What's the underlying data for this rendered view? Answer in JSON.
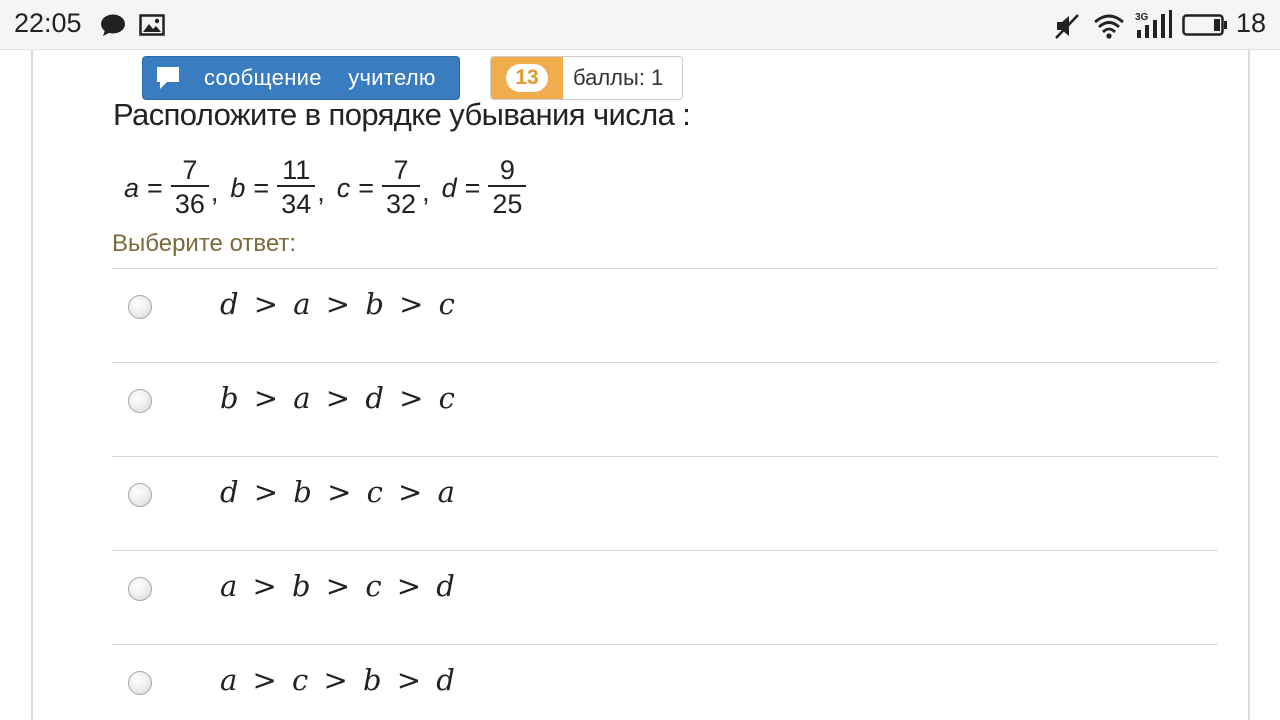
{
  "status_bar": {
    "time": "22:05",
    "battery": "18",
    "icons": [
      "chat-icon",
      "image-icon",
      "mute-icon",
      "wifi-icon",
      "signal-3g-icon",
      "battery-icon"
    ]
  },
  "toolbar": {
    "message_button": "сообщение учителю",
    "score_number": "13",
    "score_label": "баллы: 1"
  },
  "question": {
    "text": "Расположите в порядке убывания числа :",
    "formula": [
      {
        "var": "a",
        "num": "7",
        "den": "36"
      },
      {
        "var": "b",
        "num": "11",
        "den": "34"
      },
      {
        "var": "c",
        "num": "7",
        "den": "32"
      },
      {
        "var": "d",
        "num": "9",
        "den": "25"
      }
    ]
  },
  "answer": {
    "prompt": "Выберите ответ:",
    "options": [
      "d > a > b > c",
      "b > a > d > c",
      "d > b > c > a",
      "a > b > c > d",
      "a > c > b > d"
    ]
  },
  "colors": {
    "button_blue": "#3a7cc0",
    "badge_orange": "#f0ad4e",
    "prompt_color": "#7b6a3c"
  }
}
